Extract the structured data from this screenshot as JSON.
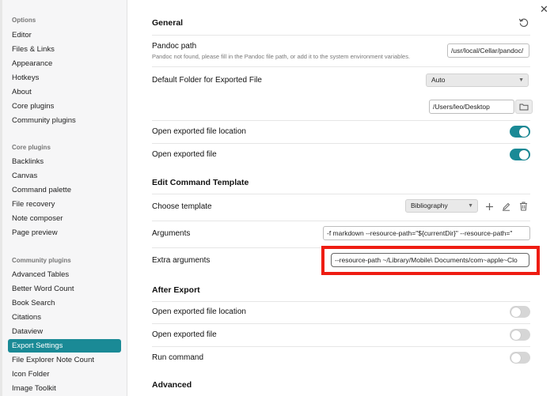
{
  "sidebar": {
    "sections": [
      {
        "heading": "Options",
        "items": [
          "Editor",
          "Files & Links",
          "Appearance",
          "Hotkeys",
          "About",
          "Core plugins",
          "Community plugins"
        ]
      },
      {
        "heading": "Core plugins",
        "items": [
          "Backlinks",
          "Canvas",
          "Command palette",
          "File recovery",
          "Note composer",
          "Page preview"
        ]
      },
      {
        "heading": "Community plugins",
        "items": [
          "Advanced Tables",
          "Better Word Count",
          "Book Search",
          "Citations",
          "Dataview",
          "Export Settings",
          "File Explorer Note Count",
          "Icon Folder",
          "Image Toolkit"
        ]
      }
    ],
    "active_item": "Export Settings",
    "accent_color": "#1a8a96"
  },
  "close_label": "✕",
  "general": {
    "title": "General",
    "reset_icon": "reset-icon",
    "pandoc_path_label": "Pandoc path",
    "pandoc_path_desc": "Pandoc not found, please fill in the Pandoc file path, or add it to the system environment variables.",
    "pandoc_path_value": "/usr/local/Cellar/pandoc/",
    "default_folder_label": "Default Folder for Exported File",
    "default_folder_value": "Auto",
    "folder_path_value": "/Users/leo/Desktop",
    "open_location_label": "Open exported file location",
    "open_location_on": true,
    "open_file_label": "Open exported file",
    "open_file_on": true
  },
  "template": {
    "title": "Edit Command Template",
    "choose_label": "Choose template",
    "choose_value": "Bibliography",
    "arguments_label": "Arguments",
    "arguments_value": "-f markdown --resource-path=\"${currentDir}\" --resource-path=\"",
    "extra_label": "Extra arguments",
    "extra_value": "--resource-path ~/Library/Mobile\\ Documents/com~apple~Clo"
  },
  "after_export": {
    "title": "After Export",
    "open_location_label": "Open exported file location",
    "open_location_on": false,
    "open_file_label": "Open exported file",
    "open_file_on": false,
    "run_command_label": "Run command",
    "run_command_on": false
  },
  "advanced": {
    "title": "Advanced"
  },
  "highlight_color": "#ee1c12"
}
